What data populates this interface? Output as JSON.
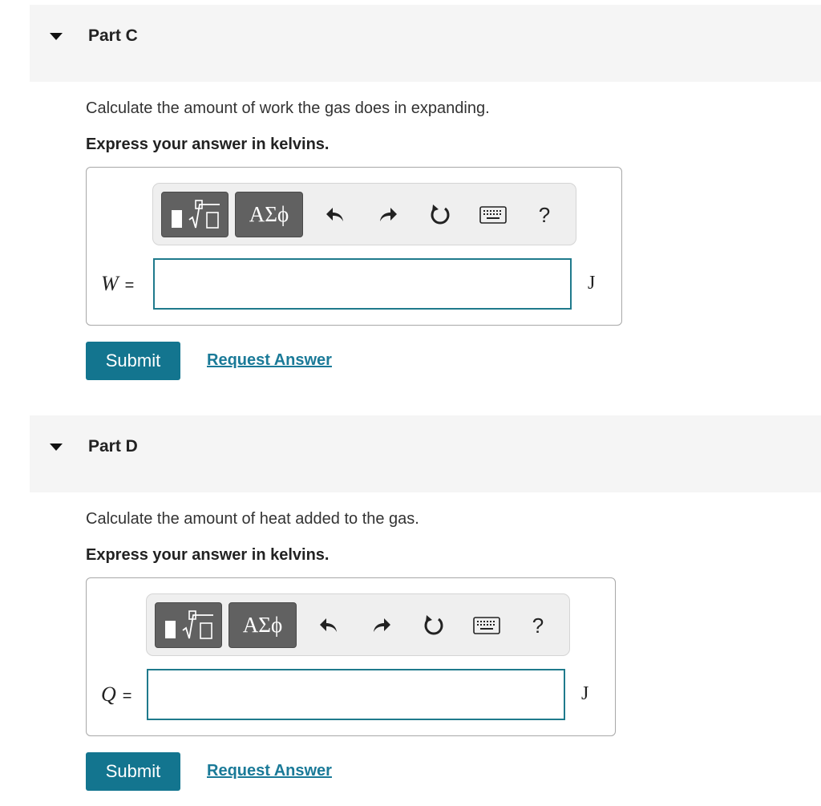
{
  "parts": [
    {
      "title": "Part C",
      "question": "Calculate the amount of work the gas does in expanding.",
      "instruction": "Express your answer in kelvins.",
      "variable": "W",
      "equals": "=",
      "input_value": "",
      "unit": "J",
      "toolbar": {
        "template_icon": "fraction-root-template-icon",
        "greek_label": "ΑΣϕ",
        "undo_icon": "undo-icon",
        "redo_icon": "redo-icon",
        "reset_icon": "reset-icon",
        "keyboard_icon": "keyboard-icon",
        "help_label": "?"
      },
      "submit_label": "Submit",
      "request_label": "Request Answer"
    },
    {
      "title": "Part D",
      "question": "Calculate the amount of heat added to the gas.",
      "instruction": "Express your answer in kelvins.",
      "variable": "Q",
      "equals": "=",
      "input_value": "",
      "unit": "J",
      "toolbar": {
        "template_icon": "fraction-root-template-icon",
        "greek_label": "ΑΣϕ",
        "undo_icon": "undo-icon",
        "redo_icon": "redo-icon",
        "reset_icon": "reset-icon",
        "keyboard_icon": "keyboard-icon",
        "help_label": "?"
      },
      "submit_label": "Submit",
      "request_label": "Request Answer"
    }
  ],
  "colors": {
    "header_bg": "#f5f5f5",
    "submit_bg": "#13758f",
    "link": "#1a7a98",
    "input_border": "#1f7a8c",
    "toolbar_button": "#616161"
  }
}
